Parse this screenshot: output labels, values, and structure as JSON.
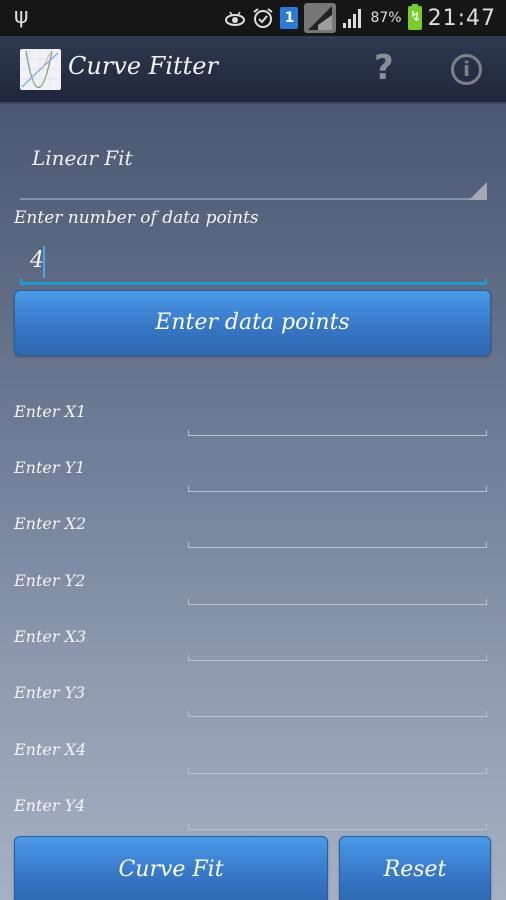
{
  "status_bar": {
    "usb_icon": "usb-icon",
    "icons": [
      "eye-icon",
      "alarm-icon",
      "sim-1-icon",
      "signal-icon",
      "signal-bars-icon"
    ],
    "sim_label": "1",
    "battery_percent": "87%",
    "time": "21:47"
  },
  "action_bar": {
    "title": "Curve Fitter",
    "help_glyph": "?",
    "info_glyph": "i"
  },
  "form": {
    "fit_type": "Linear Fit",
    "num_points_label": "Enter number of data points",
    "num_points_value": "4",
    "enter_button": "Enter data points",
    "points": [
      {
        "label": "Enter X1",
        "value": ""
      },
      {
        "label": "Enter Y1",
        "value": ""
      },
      {
        "label": "Enter X2",
        "value": ""
      },
      {
        "label": "Enter Y2",
        "value": ""
      },
      {
        "label": "Enter X3",
        "value": ""
      },
      {
        "label": "Enter Y3",
        "value": ""
      },
      {
        "label": "Enter X4",
        "value": ""
      },
      {
        "label": "Enter Y4",
        "value": ""
      }
    ],
    "curve_fit_button": "Curve Fit",
    "reset_button": "Reset"
  }
}
